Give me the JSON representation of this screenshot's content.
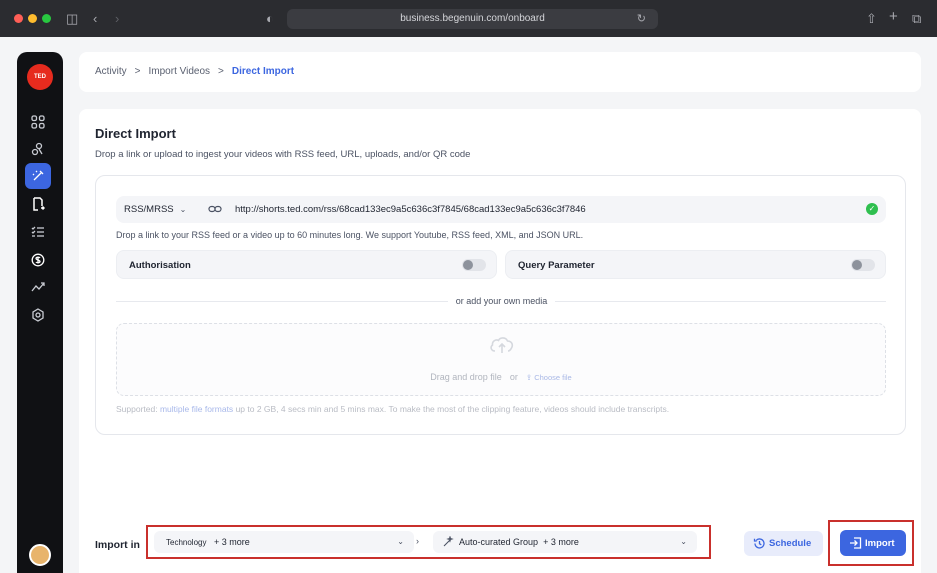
{
  "browser": {
    "url": "business.begenuin.com/onboard"
  },
  "sidebar": {
    "logo_text": "TED"
  },
  "breadcrumb": {
    "items": [
      "Activity",
      "Import Videos",
      "Direct Import"
    ],
    "separator": ">"
  },
  "page": {
    "title": "Direct Import",
    "subtitle": "Drop a link or upload to ingest your videos with RSS feed, URL, uploads, and/or QR code"
  },
  "source": {
    "type_select": "RSS/MRSS",
    "url_value": "http://shorts.ted.com/rss/68cad133ec9a5c636c3f7845/68cad133ec9a5c636c3f7846",
    "helper_text": "Drop a link to your RSS feed or a video up to 60 minutes long. We support Youtube, RSS feed, XML, and JSON URL."
  },
  "toggles": {
    "authorisation_label": "Authorisation",
    "authorisation_on": false,
    "query_parameter_label": "Query Parameter",
    "query_parameter_on": false
  },
  "upload": {
    "divider_text": "or add your own media",
    "drag_text": "Drag and drop file",
    "or_text": "or",
    "choose_file": "Choose file",
    "supported_prefix": "Supported:",
    "supported_link": "multiple file formats",
    "supported_suffix": "up to 2 GB, 4 secs min and 5 mins max. To make the most of the clipping feature, videos should include transcripts."
  },
  "import_bar": {
    "label": "Import in",
    "category": "Technology",
    "category_more": "+ 3 more",
    "group": "Auto-curated Group",
    "group_more": "+ 3 more",
    "schedule_label": "Schedule",
    "import_label": "Import"
  },
  "colors": {
    "accent": "#3c66e0",
    "brand_red": "#e62b1e",
    "success": "#2fbf4f",
    "highlight_border": "#c9302c"
  }
}
